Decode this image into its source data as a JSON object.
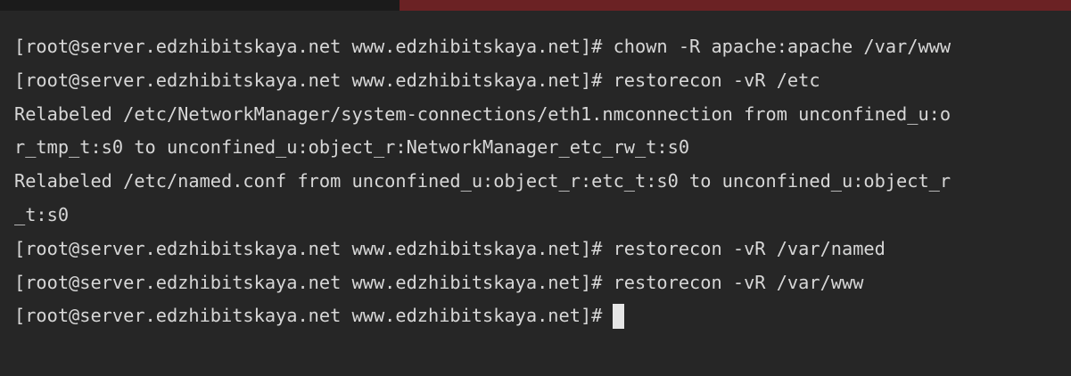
{
  "terminal": {
    "lines": [
      "[root@server.edzhibitskaya.net www.edzhibitskaya.net]# chown -R apache:apache /var/www",
      "[root@server.edzhibitskaya.net www.edzhibitskaya.net]# restorecon -vR /etc",
      "Relabeled /etc/NetworkManager/system-connections/eth1.nmconnection from unconfined_u:o",
      "r_tmp_t:s0 to unconfined_u:object_r:NetworkManager_etc_rw_t:s0",
      "Relabeled /etc/named.conf from unconfined_u:object_r:etc_t:s0 to unconfined_u:object_r",
      "_t:s0",
      "[root@server.edzhibitskaya.net www.edzhibitskaya.net]# restorecon -vR /var/named",
      "[root@server.edzhibitskaya.net www.edzhibitskaya.net]# restorecon -vR /var/www"
    ],
    "prompt": "[root@server.edzhibitskaya.net www.edzhibitskaya.net]#"
  },
  "colors": {
    "background": "#262626",
    "text": "#d7d7d7",
    "title_bar_accent": "#6b2224",
    "cursor": "#e6e6e6"
  }
}
